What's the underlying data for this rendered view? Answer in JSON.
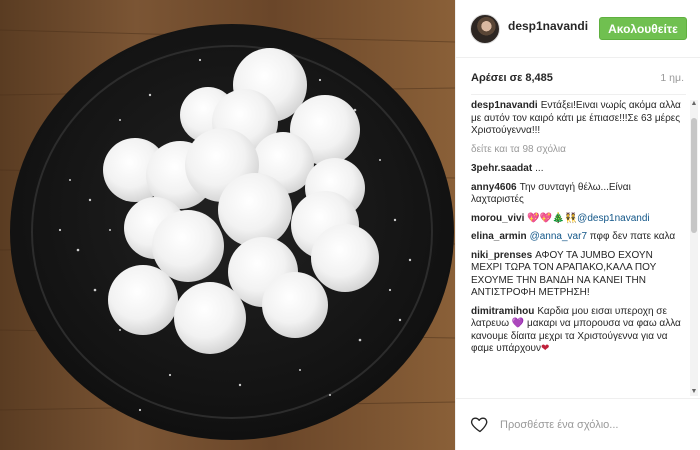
{
  "post": {
    "username": "desp1navandi",
    "follow_label": "Ακολουθείτε",
    "likes": "Αρέσει σε 8,485",
    "time": "1 ημ."
  },
  "caption": {
    "user": "desp1navandi",
    "text": "Εντάξει!Ειναι νωρίς ακόμα αλλα με αυτόν τον καιρό κάτι με έπιασε!!!Σε 63 μέρες Χριστούγεννα!!!"
  },
  "more_comments": "δείτε και τα 98 σχόλια",
  "comments": [
    {
      "user": "3pehr.saadat",
      "text": "..."
    },
    {
      "user": "anny4606",
      "text": "Την συνταγή θέλω...Είναι λαχταριστές"
    },
    {
      "user": "morou_vivi",
      "emoji": "💖💖🎄👯",
      "mention": "@desp1navandi"
    },
    {
      "user": "elina_armin",
      "mention": "@anna_var7",
      "text": "πφφ δεν πατε καλα"
    },
    {
      "user": "niki_prenses",
      "text": "ΑΦΟΥ ΤΑ JUMBO ΕΧΟΥΝ ΜΕΧΡΙ ΤΩΡΑ ΤΟΝ ΑΡΑΠΑΚΟ,ΚΑΛΑ ΠΟΥ ΕΧΟΥΜΕ ΤΗΝ ΒΑΝΔΗ ΝΑ ΚΑΝΕΙ ΤΗΝ ΑΝΤΙΣΤΡΟΦΗ ΜΕΤΡΗΣΗ!"
    },
    {
      "user": "dimitramihou",
      "text_a": "Καρδια μου εισαι υπεροχη σε λατρευω",
      "heart": "💜",
      "text_b": "μακαρι να μπορουσα να φαω αλλα κανουμε δίαιτα μεχρι τα Χριστούγεννα για να φαμε υπάρχουν",
      "heart2": "❤"
    }
  ],
  "footer": {
    "placeholder": "Προσθέστε ένα σχόλιο...",
    "like_icon": "heart-outline-icon"
  },
  "colors": {
    "follow_green": "#70c050",
    "mention_blue": "#125688",
    "plate_dark": "#1a1a1a",
    "wood_brown": "#6b4a2b"
  }
}
